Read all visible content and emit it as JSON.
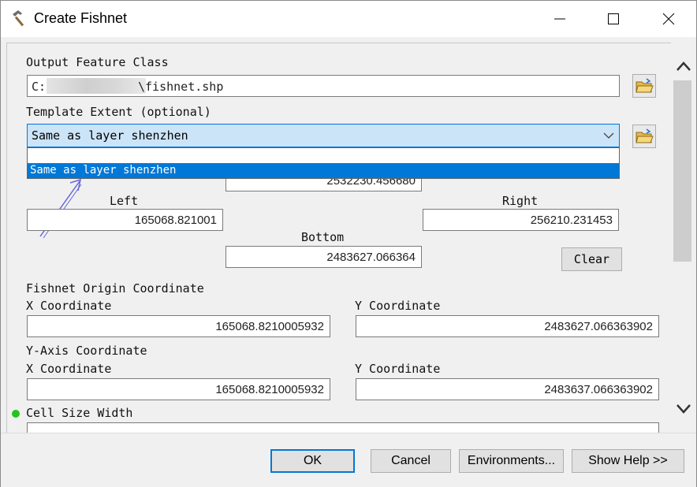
{
  "window": {
    "title": "Create Fishnet",
    "controls": [
      "minimize-icon",
      "maximize-icon",
      "close-icon"
    ]
  },
  "output_feature_class": {
    "label": "Output Feature Class",
    "value_prefix": "C:",
    "value_suffix": "\\fishnet.shp"
  },
  "template_extent": {
    "label": "Template Extent (optional)",
    "selected": "Same as layer shenzhen",
    "options": [
      "",
      "Same as layer shenzhen"
    ]
  },
  "extent": {
    "top_value": "2532230.456680",
    "left_label": "Left",
    "left_value": "165068.821001",
    "right_label": "Right",
    "right_value": "256210.231453",
    "bottom_label": "Bottom",
    "bottom_value": "2483627.066364",
    "clear_label": "Clear"
  },
  "fishnet_origin": {
    "label": "Fishnet Origin Coordinate",
    "x_label": "X Coordinate",
    "x_value": "165068.8210005932",
    "y_label": "Y Coordinate",
    "y_value": "2483627.066363902"
  },
  "y_axis": {
    "label": "Y-Axis Coordinate",
    "x_label": "X Coordinate",
    "x_value": "165068.8210005932",
    "y_label": "Y Coordinate",
    "y_value": "2483637.066363902"
  },
  "cell_size_width": {
    "label": "Cell Size Width",
    "value": ""
  },
  "buttons": {
    "ok": "OK",
    "cancel": "Cancel",
    "environments": "Environments...",
    "show_help": "Show Help >>"
  },
  "colors": {
    "accent": "#0078d7",
    "selection_bg": "#cce4f7",
    "required_dot": "#22c51d"
  }
}
